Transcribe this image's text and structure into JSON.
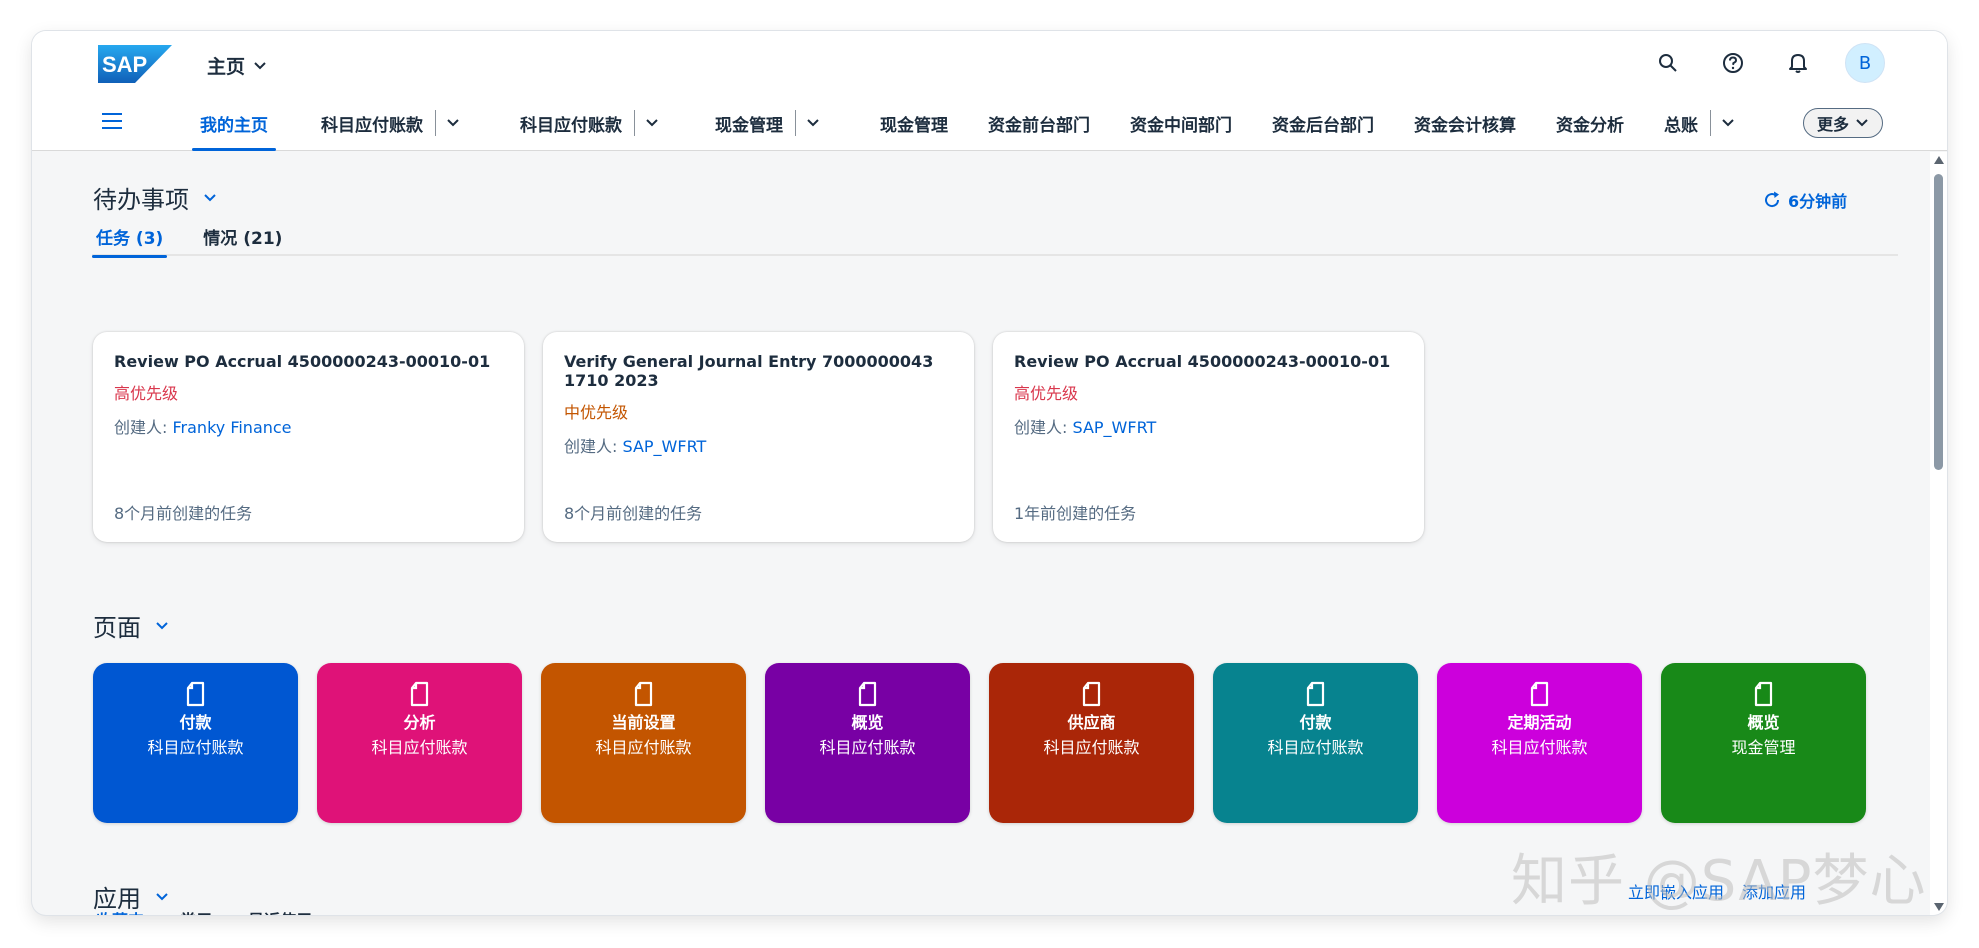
{
  "shell": {
    "logo_text": "SAP",
    "app_title": "主页",
    "avatar_initial": "B",
    "colors": {
      "brand_blue": "#0064d9",
      "logo_blue": "#1872c7"
    }
  },
  "nav": {
    "items": [
      {
        "label": "我的主页",
        "active": true,
        "dropdown": false
      },
      {
        "label": "科目应付账款",
        "active": false,
        "dropdown": true
      },
      {
        "label": "科目应付账款",
        "active": false,
        "dropdown": true
      },
      {
        "label": "现金管理",
        "active": false,
        "dropdown": true
      },
      {
        "label": "现金管理",
        "active": false,
        "dropdown": false
      },
      {
        "label": "资金前台部门",
        "active": false,
        "dropdown": false
      },
      {
        "label": "资金中间部门",
        "active": false,
        "dropdown": false
      },
      {
        "label": "资金后台部门",
        "active": false,
        "dropdown": false
      },
      {
        "label": "资金会计核算",
        "active": false,
        "dropdown": false
      },
      {
        "label": "资金分析",
        "active": false,
        "dropdown": false
      },
      {
        "label": "总账",
        "active": false,
        "dropdown": true
      }
    ],
    "more_label": "更多"
  },
  "todo": {
    "title": "待办事项",
    "refresh_label": "6分钟前",
    "tabs": [
      {
        "label": "任务 (3)",
        "active": true
      },
      {
        "label": "情况 (21)",
        "active": false
      }
    ],
    "cards": [
      {
        "title": "Review PO Accrual 4500000243-00010-01",
        "priority": "高优先级",
        "priority_level": "high",
        "creator_label": "创建人:",
        "creator": "Franky Finance",
        "footer": "8个月前创建的任务"
      },
      {
        "title": "Verify General Journal Entry 7000000043 1710 2023",
        "priority": "中优先级",
        "priority_level": "mid",
        "creator_label": "创建人:",
        "creator": "SAP_WFRT",
        "footer": "8个月前创建的任务"
      },
      {
        "title": "Review PO Accrual 4500000243-00010-01",
        "priority": "高优先级",
        "priority_level": "high",
        "creator_label": "创建人:",
        "creator": "SAP_WFRT",
        "footer": "1年前创建的任务"
      }
    ]
  },
  "pages": {
    "title": "页面",
    "tiles": [
      {
        "title": "付款",
        "subtitle": "科目应付账款",
        "color": "#0057d2"
      },
      {
        "title": "分析",
        "subtitle": "科目应付账款",
        "color": "#df1278"
      },
      {
        "title": "当前设置",
        "subtitle": "科目应付账款",
        "color": "#c35500"
      },
      {
        "title": "概览",
        "subtitle": "科目应付账款",
        "color": "#7800a4"
      },
      {
        "title": "供应商",
        "subtitle": "科目应付账款",
        "color": "#aa2608"
      },
      {
        "title": "付款",
        "subtitle": "科目应付账款",
        "color": "#07838f"
      },
      {
        "title": "定期活动",
        "subtitle": "科目应付账款",
        "color": "#cc00dc"
      },
      {
        "title": "概览",
        "subtitle": "现金管理",
        "color": "#188918"
      }
    ]
  },
  "apps": {
    "title": "应用",
    "actions": [
      "立即嵌入应用",
      "添加应用"
    ],
    "tabs": [
      "收藏夹",
      "常用",
      "最近使用"
    ]
  },
  "watermark": "知乎 @SAP梦心"
}
